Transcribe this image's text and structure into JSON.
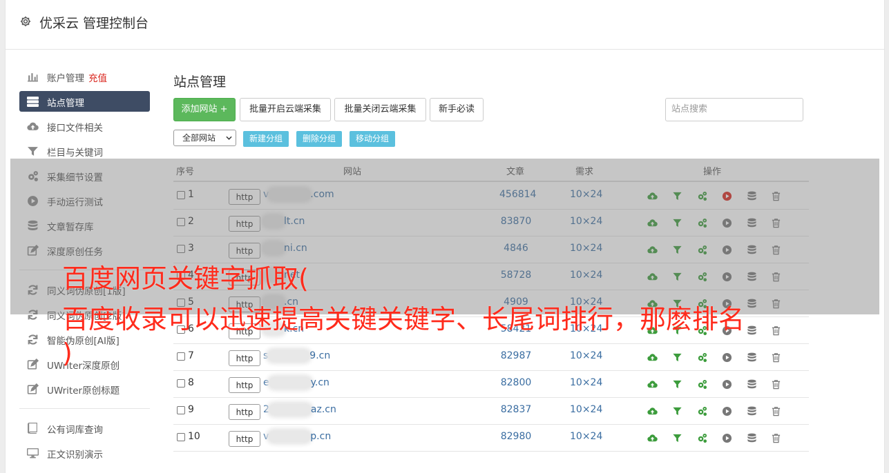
{
  "header": {
    "title": "优采云 管理控制台",
    "icon": "gear-icon"
  },
  "sidebar": {
    "items": [
      {
        "label": "账户管理",
        "extra": "充值",
        "icon": "bar-chart-icon",
        "active": false
      },
      {
        "label": "站点管理",
        "extra": "",
        "icon": "server-icon",
        "active": true
      },
      {
        "label": "接口文件相关",
        "extra": "",
        "icon": "cloud-upload-icon",
        "active": false
      },
      {
        "label": "栏目与关键词",
        "extra": "",
        "icon": "filter-icon",
        "active": false
      },
      {
        "label": "采集细节设置",
        "extra": "",
        "icon": "cogs-icon",
        "active": false
      },
      {
        "label": "手动运行测试",
        "extra": "",
        "icon": "play-circle-icon",
        "active": false
      },
      {
        "label": "文章暂存库",
        "extra": "",
        "icon": "database-icon",
        "active": false
      },
      {
        "label": "深度原创任务",
        "extra": "",
        "icon": "edit-icon",
        "active": false
      },
      {
        "label": "同义词伪原创[1版]",
        "extra": "",
        "icon": "refresh-icon",
        "active": false
      },
      {
        "label": "同义词伪原创[2版]",
        "extra": "",
        "icon": "refresh-icon",
        "active": false
      },
      {
        "label": "智能伪原创[AI版]",
        "extra": "",
        "icon": "refresh-icon",
        "active": false
      },
      {
        "label": "UWriter深度原创",
        "extra": "",
        "icon": "edit-icon",
        "active": false
      },
      {
        "label": "UWriter原创标题",
        "extra": "",
        "icon": "edit-icon",
        "active": false
      },
      {
        "label": "公有词库查询",
        "extra": "",
        "icon": "book-icon",
        "active": false
      },
      {
        "label": "正文识别演示",
        "extra": "",
        "icon": "monitor-icon",
        "active": false
      }
    ]
  },
  "main": {
    "title": "站点管理",
    "add_button": "添加网站 +",
    "batch_open": "批量开启云端采集",
    "batch_close": "批量关闭云端采集",
    "guide": "新手必读",
    "search_placeholder": "站点搜索",
    "group_select": "全部网站",
    "new_group": "新建分组",
    "delete_group": "删除分组",
    "move_group": "移动分组"
  },
  "table": {
    "headers": {
      "index": "序号",
      "site": "网站",
      "articles": "文章",
      "demand": "需求",
      "actions": "操作"
    },
    "rows": [
      {
        "index": "1",
        "protocol": "http",
        "site_prefix": "v",
        "site_suffix": ".com",
        "articles": "456814",
        "demand": "10×24",
        "play_active": true
      },
      {
        "index": "2",
        "protocol": "http",
        "site_prefix": "",
        "site_suffix": "lt.cn",
        "articles": "83870",
        "demand": "10×24",
        "play_active": false
      },
      {
        "index": "3",
        "protocol": "http",
        "site_prefix": "",
        "site_suffix": "ni.cn",
        "articles": "4846",
        "demand": "10×24",
        "play_active": false
      },
      {
        "index": "4",
        "protocol": "http",
        "site_prefix": "",
        "site_suffix": "net",
        "articles": "58728",
        "demand": "10×24",
        "play_active": false
      },
      {
        "index": "5",
        "protocol": "http",
        "site_prefix": "",
        "site_suffix": ".cn",
        "articles": "4909",
        "demand": "10×24",
        "play_active": false
      },
      {
        "index": "6",
        "protocol": "http",
        "site_prefix": "",
        "site_suffix": "k.cn",
        "articles": "58421",
        "demand": "10×24",
        "play_active": false
      },
      {
        "index": "7",
        "protocol": "http",
        "site_prefix": "s",
        "site_suffix": "9.cn",
        "articles": "82987",
        "demand": "10×24",
        "play_active": false
      },
      {
        "index": "8",
        "protocol": "http",
        "site_prefix": "e",
        "site_suffix": "y.cn",
        "articles": "82800",
        "demand": "10×24",
        "play_active": false
      },
      {
        "index": "9",
        "protocol": "http",
        "site_prefix": "2",
        "site_suffix": "az.cn",
        "articles": "82837",
        "demand": "10×24",
        "play_active": false
      },
      {
        "index": "10",
        "protocol": "http",
        "site_prefix": "v",
        "site_suffix": "p.cn",
        "articles": "82980",
        "demand": "10×24",
        "play_active": false
      }
    ]
  },
  "overlay": {
    "line1": "百度网页关键字抓取(",
    "line2": "百度收录可以迅速提高关键关键字、长尾词排行，那麽排名",
    "line3": ")"
  },
  "colors": {
    "accent": "#3e4c64",
    "green": "#5cb85c",
    "info": "#5bc0de",
    "link": "#3a6da1",
    "red": "#d9251d",
    "overlay_text": "#ff2b1c"
  }
}
